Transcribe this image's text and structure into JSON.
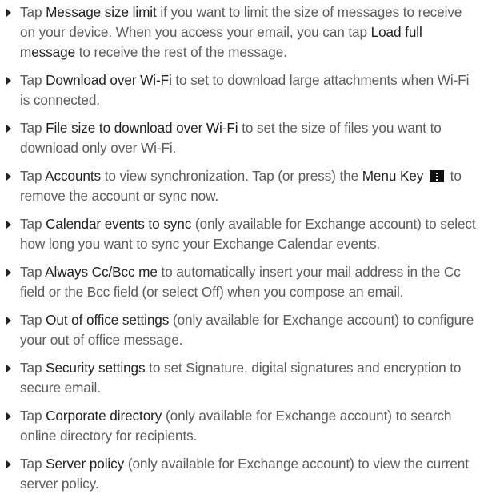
{
  "items": [
    {
      "id": "message-size-limit",
      "parts": [
        {
          "t": "Tap "
        },
        {
          "t": "Message size limit",
          "em": true
        },
        {
          "t": " if you want to limit the size of messages to receive on your device. When you access your email, you can tap "
        },
        {
          "t": "Load full message",
          "em": true
        },
        {
          "t": " to receive the rest of the message."
        }
      ]
    },
    {
      "id": "download-over-wifi",
      "parts": [
        {
          "t": "Tap "
        },
        {
          "t": "Download over Wi-Fi",
          "em": true
        },
        {
          "t": " to set to download large attachments when Wi-Fi is connected."
        }
      ]
    },
    {
      "id": "file-size-over-wifi",
      "parts": [
        {
          "t": "Tap "
        },
        {
          "t": "File size to download over Wi-Fi",
          "em": true
        },
        {
          "t": " to set the size of files you want to download only over Wi-Fi."
        }
      ]
    },
    {
      "id": "accounts",
      "parts": [
        {
          "t": "Tap "
        },
        {
          "t": "Accounts",
          "em": true
        },
        {
          "t": " to view synchronization. Tap (or press) the "
        },
        {
          "t": "Menu Key",
          "em": true
        },
        {
          "t": " "
        },
        {
          "icon": "menu-key-icon"
        },
        {
          "t": " to remove the account or sync now."
        }
      ]
    },
    {
      "id": "calendar-events-to-sync",
      "parts": [
        {
          "t": "Tap "
        },
        {
          "t": "Calendar events to sync",
          "em": true
        },
        {
          "t": " (only available for Exchange account) to select how long you want to sync your Exchange Calendar events."
        }
      ]
    },
    {
      "id": "always-cc-bcc-me",
      "parts": [
        {
          "t": "Tap "
        },
        {
          "t": "Always Cc/Bcc me",
          "em": true
        },
        {
          "t": " to automatically insert your mail address in the Cc field or the Bcc field (or select Off) when you compose an email."
        }
      ]
    },
    {
      "id": "out-of-office-settings",
      "parts": [
        {
          "t": "Tap "
        },
        {
          "t": "Out of office settings",
          "em": true
        },
        {
          "t": " (only available for Exchange account) to configure your out of office message."
        }
      ]
    },
    {
      "id": "security-settings",
      "parts": [
        {
          "t": "Tap "
        },
        {
          "t": "Security settings",
          "em": true
        },
        {
          "t": " to set Signature, digital signatures and encryption to secure email."
        }
      ]
    },
    {
      "id": "corporate-directory",
      "parts": [
        {
          "t": "Tap "
        },
        {
          "t": "Corporate directory",
          "em": true
        },
        {
          "t": " (only available for Exchange account) to search online directory for recipients."
        }
      ]
    },
    {
      "id": "server-policy",
      "parts": [
        {
          "t": "Tap "
        },
        {
          "t": "Server policy",
          "em": true
        },
        {
          "t": " (only available for Exchange account) to view the current server policy."
        }
      ]
    }
  ]
}
